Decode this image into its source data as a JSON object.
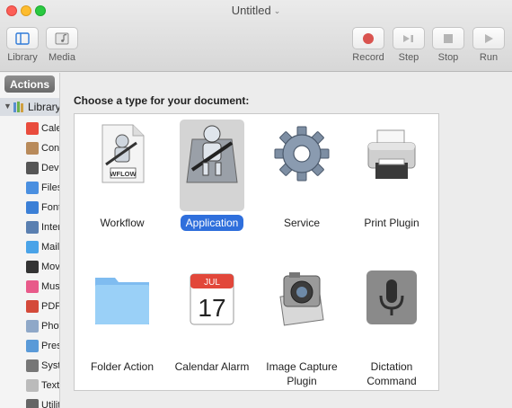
{
  "window": {
    "title": "Untitled"
  },
  "toolbar": {
    "library_label": "Library",
    "media_label": "Media",
    "record_label": "Record",
    "step_label": "Step",
    "stop_label": "Stop",
    "run_label": "Run"
  },
  "sidebar": {
    "actions_tab": "Actions",
    "library_label": "Library",
    "items": [
      {
        "label": "Cale",
        "icon": "calendar-icon",
        "color": "#e94c3d"
      },
      {
        "label": "Cont",
        "icon": "contacts-icon",
        "color": "#b88a5a"
      },
      {
        "label": "Deve",
        "icon": "developer-icon",
        "color": "#555555"
      },
      {
        "label": "Files",
        "icon": "files-icon",
        "color": "#4a8fe0"
      },
      {
        "label": "Font",
        "icon": "fonts-icon",
        "color": "#3b7fd6"
      },
      {
        "label": "Inter",
        "icon": "internet-icon",
        "color": "#5a7fb0"
      },
      {
        "label": "Mail",
        "icon": "mail-icon",
        "color": "#4aa3e8"
      },
      {
        "label": "Movi",
        "icon": "movies-icon",
        "color": "#333333"
      },
      {
        "label": "Musi",
        "icon": "music-icon",
        "color": "#e85a8a"
      },
      {
        "label": "PDFs",
        "icon": "pdfs-icon",
        "color": "#d44a3a"
      },
      {
        "label": "Phot",
        "icon": "photos-icon",
        "color": "#8fa8c8"
      },
      {
        "label": "Pres",
        "icon": "presentations-icon",
        "color": "#5a9ad8"
      },
      {
        "label": "Syste",
        "icon": "system-icon",
        "color": "#777777"
      },
      {
        "label": "Text",
        "icon": "text-icon",
        "color": "#bbbbbb"
      },
      {
        "label": "Utiliti",
        "icon": "utilities-icon",
        "color": "#666666"
      }
    ]
  },
  "main": {
    "prompt": "Choose a type for your document:",
    "types": [
      {
        "label": "Workflow",
        "icon": "workflow-icon",
        "badge": "WFLOW"
      },
      {
        "label": "Application",
        "icon": "application-icon",
        "selected": true
      },
      {
        "label": "Service",
        "icon": "service-gear-icon"
      },
      {
        "label": "Print Plugin",
        "icon": "printer-icon"
      },
      {
        "label": "Folder Action",
        "icon": "folder-icon"
      },
      {
        "label": "Calendar Alarm",
        "icon": "calendar-alarm-icon",
        "month": "JUL",
        "day": "17"
      },
      {
        "label": "Image Capture Plugin",
        "icon": "camera-icon"
      },
      {
        "label": "Dictation Command",
        "icon": "microphone-icon"
      }
    ]
  },
  "colors": {
    "accent": "#2f6fdc",
    "record": "#d9534f"
  }
}
